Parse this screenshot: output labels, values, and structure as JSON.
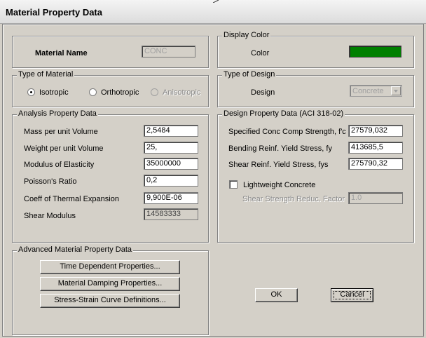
{
  "window": {
    "title": "Material Property Data"
  },
  "material": {
    "name_label": "Material Name",
    "name_value": "CONC"
  },
  "display_color": {
    "legend": "Display Color",
    "color_label": "Color",
    "swatch_color": "#008000"
  },
  "type_of_material": {
    "legend": "Type of Material",
    "options": [
      {
        "label": "Isotropic",
        "selected": true,
        "enabled": true
      },
      {
        "label": "Orthotropic",
        "selected": false,
        "enabled": true
      },
      {
        "label": "Anisotropic",
        "selected": false,
        "enabled": false
      }
    ]
  },
  "type_of_design": {
    "legend": "Type of Design",
    "design_label": "Design",
    "design_value": "Concrete"
  },
  "analysis": {
    "legend": "Analysis Property Data",
    "fields": [
      {
        "label": "Mass per unit Volume",
        "value": "2,5484"
      },
      {
        "label": "Weight per unit Volume",
        "value": "25,"
      },
      {
        "label": "Modulus of Elasticity",
        "value": "35000000"
      },
      {
        "label": "Poisson's Ratio",
        "value": "0,2"
      },
      {
        "label": "Coeff of Thermal Expansion",
        "value": "9,900E-06"
      },
      {
        "label": "Shear Modulus",
        "value": "14583333"
      }
    ]
  },
  "design_props": {
    "legend": "Design Property Data (ACI 318-02)",
    "fields": [
      {
        "label": "Specified Conc Comp Strength, f'c",
        "value": "27579,032"
      },
      {
        "label": "Bending Reinf. Yield Stress, fy",
        "value": "413685,5"
      },
      {
        "label": "Shear Reinf. Yield Stress, fys",
        "value": "275790,32"
      }
    ],
    "lightweight_label": "Lightweight Concrete",
    "shear_factor_label": "Shear Strength Reduc. Factor",
    "shear_factor_value": "1.0"
  },
  "advanced": {
    "legend": "Advanced Material Property Data",
    "buttons": [
      "Time Dependent Properties...",
      "Material Damping Properties...",
      "Stress-Strain Curve Definitions..."
    ]
  },
  "actions": {
    "ok_label": "OK",
    "cancel_label": "Cancel"
  }
}
